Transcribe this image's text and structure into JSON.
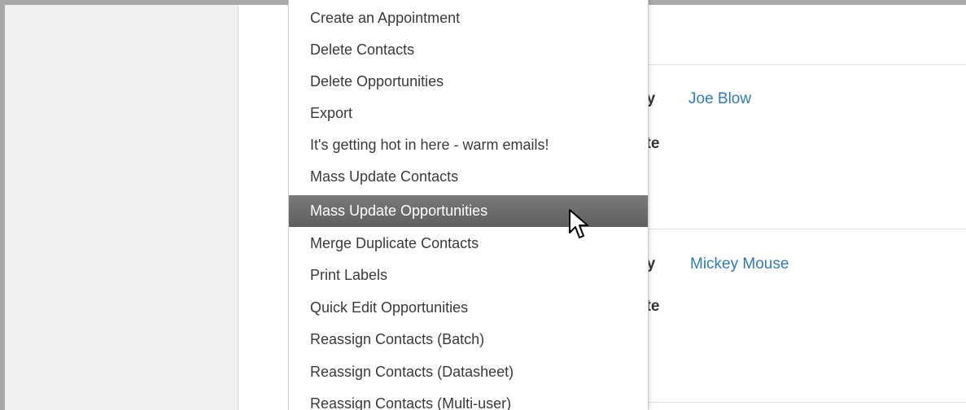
{
  "menu": {
    "items": [
      {
        "label": "Create an Appointment"
      },
      {
        "label": "Delete Contacts"
      },
      {
        "label": "Delete Opportunities"
      },
      {
        "label": "Export"
      },
      {
        "label": "It's getting hot in here - warm emails!"
      },
      {
        "label": "Mass Update Contacts"
      },
      {
        "label": "Mass Update Opportunities"
      },
      {
        "label": "Merge Duplicate Contacts"
      },
      {
        "label": "Print Labels"
      },
      {
        "label": "Quick Edit Opportunities"
      },
      {
        "label": "Reassign Contacts (Batch)"
      },
      {
        "label": "Reassign Contacts (Datasheet)"
      },
      {
        "label": "Reassign Contacts (Multi-user)"
      }
    ],
    "active_label": "Mass Update Opportunities"
  },
  "records": [
    {
      "label_1_partial": "ity",
      "label_2_partial": "ate",
      "contact": "Joe Blow"
    },
    {
      "label_1_partial": "ity",
      "label_2_partial": "ate",
      "contact": "Mickey Mouse"
    }
  ],
  "colors": {
    "link": "#2f7bbf",
    "active_item_bg": "#6b6b6b",
    "frame": "#a9a9a9"
  },
  "icons": [
    "mouse-pointer-icon"
  ]
}
